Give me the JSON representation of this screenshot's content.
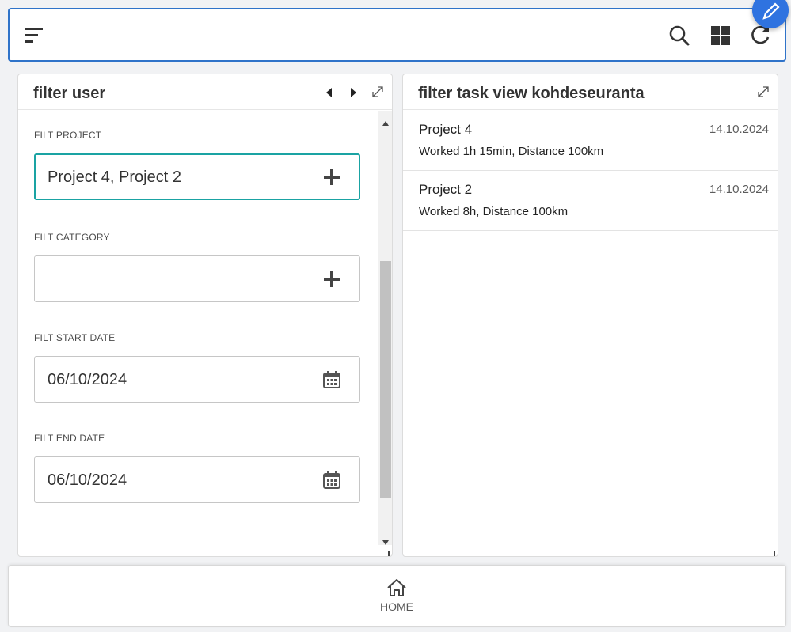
{
  "colors": {
    "accent": "#2f73c9",
    "focus": "#1aa3a3",
    "fab": "#2f73e0"
  },
  "app_bar": {
    "icons": [
      "menu-icon",
      "search-icon",
      "grid-view-icon",
      "refresh-icon",
      "edit-icon"
    ]
  },
  "left_panel": {
    "title": "filter user",
    "fields": [
      {
        "label": "FILT PROJECT",
        "value": "Project 4, Project 2",
        "icon": "plus-icon"
      },
      {
        "label": "FILT CATEGORY",
        "value": "",
        "icon": "plus-icon"
      },
      {
        "label": "FILT START DATE",
        "value": "06/10/2024",
        "icon": "calendar-icon"
      },
      {
        "label": "FILT END DATE",
        "value": "06/10/2024",
        "icon": "calendar-icon"
      }
    ]
  },
  "right_panel": {
    "title": "filter task view kohdeseuranta",
    "tasks": [
      {
        "name": "Project 4",
        "date": "14.10.2024",
        "detail": "Worked 1h 15min, Distance 100km"
      },
      {
        "name": "Project 2",
        "date": "14.10.2024",
        "detail": "Worked 8h, Distance 100km"
      }
    ]
  },
  "bottom_nav": {
    "home_label": "HOME"
  }
}
